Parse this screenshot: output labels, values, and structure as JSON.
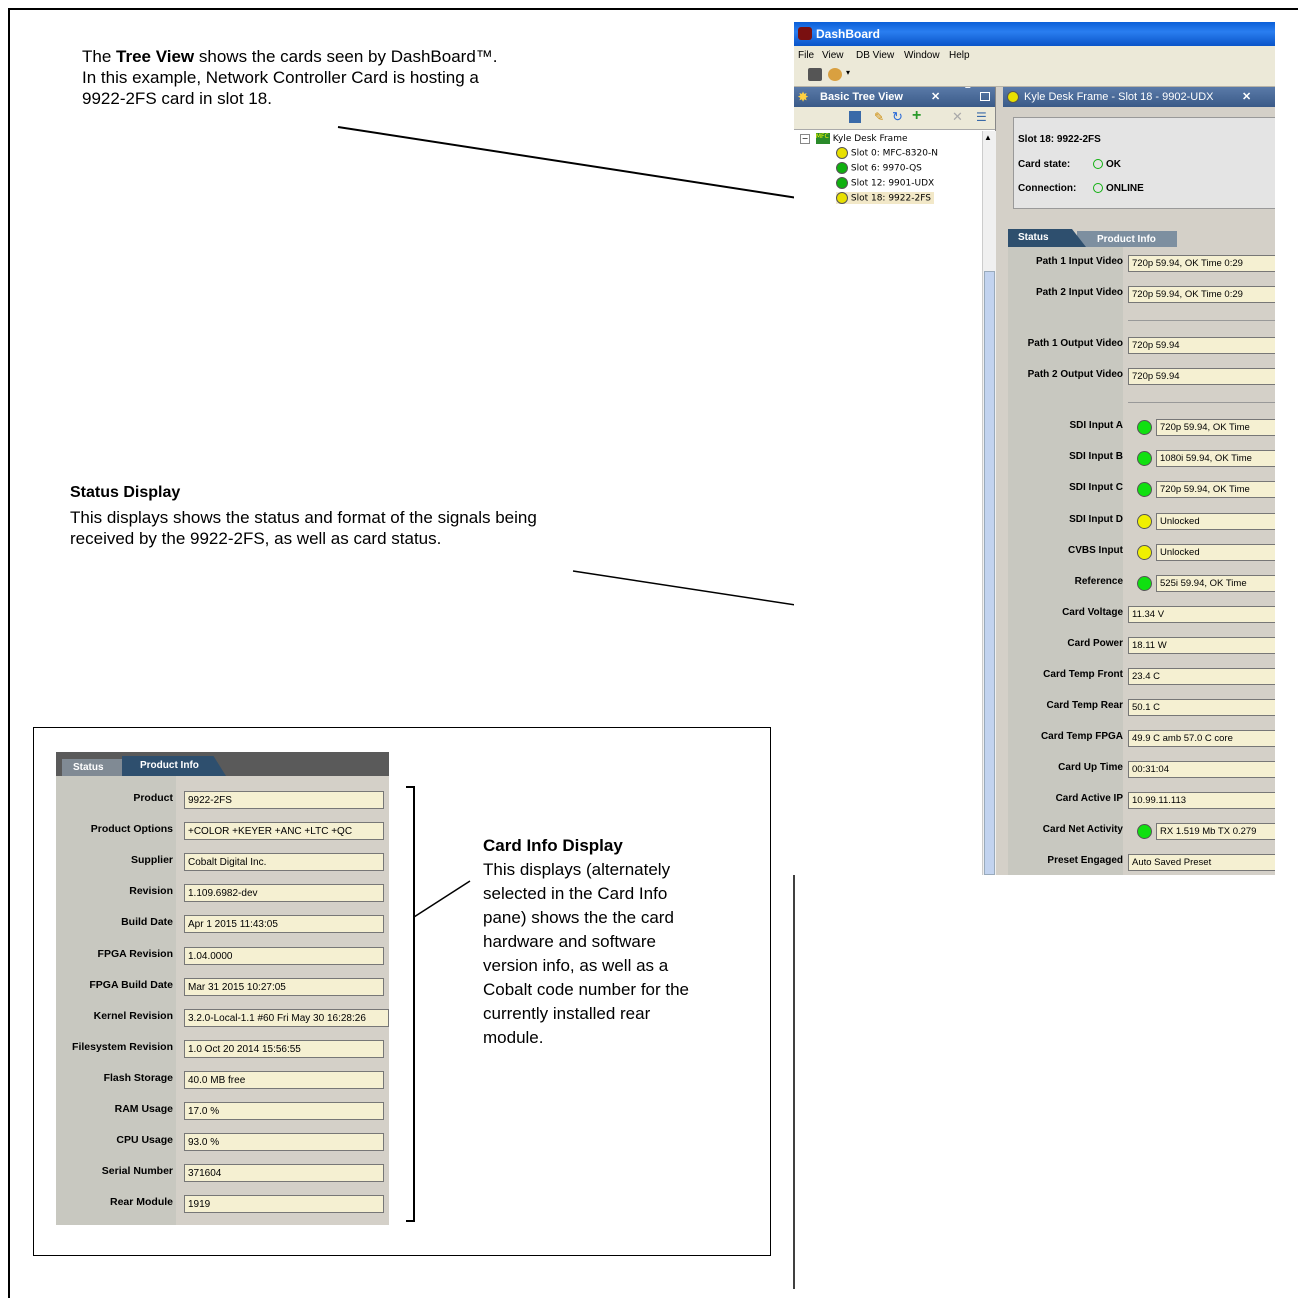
{
  "callouts": {
    "tree_view": {
      "pre": "The ",
      "bold": "Tree View",
      "line1_rest": " shows the cards seen by DashBoard™.",
      "line2": "In this example, Network Controller Card is hosting a",
      "line3": "9922-2FS card in slot 18."
    },
    "status_display": {
      "title": "Status Display",
      "line1": "This displays shows the status and format of the signals being",
      "line2": "received by the 9922-2FS, as well as card status."
    },
    "card_info": {
      "title": "Card Info Display",
      "lines": [
        "This displays (alternately",
        "selected in the Card Info",
        "pane) shows the the card",
        "hardware and software",
        "version info, as well as a",
        "Cobalt code number for the",
        "currently installed rear",
        "module."
      ]
    }
  },
  "app": {
    "title": "DashBoard",
    "menu": [
      "File",
      "View",
      "DB View",
      "Window",
      "Help"
    ]
  },
  "tree_panel": {
    "header": "Basic Tree View",
    "root": "Kyle Desk Frame",
    "root_icon_text": "MFC",
    "slots": [
      {
        "label": "Slot 0: MFC-8320-N",
        "color": "#e8e000"
      },
      {
        "label": "Slot 6: 9970-QS",
        "color": "#10b010"
      },
      {
        "label": "Slot 12: 9901-UDX",
        "color": "#10b010"
      },
      {
        "label": "Slot 18: 9922-2FS",
        "color": "#e8e000"
      }
    ]
  },
  "card_panel": {
    "tab_title": "Kyle Desk Frame - Slot 18 - 9902-UDX",
    "slot_title": "Slot 18: 9922-2FS",
    "card_state_label": "Card state:",
    "card_state_value": "OK",
    "connection_label": "Connection:",
    "connection_value": "ONLINE",
    "tabs": [
      "Status",
      "Product Info"
    ],
    "rows": [
      {
        "label": "Path 1 Input Video",
        "value": "720p 59.94, OK Time 0:29",
        "led": null
      },
      {
        "label": "Path 2 Input Video",
        "value": "720p 59.94, OK Time 0:29",
        "led": null
      },
      {
        "label": "Path 1 Output Video",
        "value": "720p 59.94",
        "led": null
      },
      {
        "label": "Path 2 Output Video",
        "value": "720p 59.94",
        "led": null
      },
      {
        "label": "SDI Input A",
        "value": "720p 59.94, OK Time",
        "led": "#10e010"
      },
      {
        "label": "SDI Input B",
        "value": "1080i 59.94, OK Time",
        "led": "#10e010"
      },
      {
        "label": "SDI Input C",
        "value": "720p 59.94, OK Time",
        "led": "#10e010"
      },
      {
        "label": "SDI Input D",
        "value": "Unlocked",
        "led": "#f0f000"
      },
      {
        "label": "CVBS Input",
        "value": "Unlocked",
        "led": "#f0f000"
      },
      {
        "label": "Reference",
        "value": "525i 59.94, OK Time",
        "led": "#10e010"
      },
      {
        "label": "Card Voltage",
        "value": "11.34 V",
        "led": null
      },
      {
        "label": "Card Power",
        "value": "18.11 W",
        "led": null
      },
      {
        "label": "Card Temp Front",
        "value": "23.4 C",
        "led": null
      },
      {
        "label": "Card Temp Rear",
        "value": "50.1 C",
        "led": null
      },
      {
        "label": "Card Temp FPGA",
        "value": "49.9 C amb 57.0 C core",
        "led": null
      },
      {
        "label": "Card Up Time",
        "value": "00:31:04",
        "led": null
      },
      {
        "label": "Card Active IP",
        "value": "10.99.11.113",
        "led": null
      },
      {
        "label": "Card Net Activity",
        "value": "RX 1.519 Mb TX 0.279",
        "led": "#10e010"
      },
      {
        "label": "Preset Engaged",
        "value": "Auto Saved Preset",
        "led": null
      }
    ]
  },
  "product_info": {
    "tabs": [
      "Status",
      "Product Info"
    ],
    "rows": [
      {
        "label": "Product",
        "value": "9922-2FS"
      },
      {
        "label": "Product Options",
        "value": "+COLOR +KEYER +ANC +LTC +QC"
      },
      {
        "label": "Supplier",
        "value": "Cobalt Digital Inc."
      },
      {
        "label": "Revision",
        "value": "1.109.6982-dev"
      },
      {
        "label": "Build Date",
        "value": "Apr 1 2015 11:43:05"
      },
      {
        "label": "FPGA Revision",
        "value": "1.04.0000"
      },
      {
        "label": "FPGA Build Date",
        "value": "Mar 31 2015 10:27:05"
      },
      {
        "label": "Kernel Revision",
        "value": "3.2.0-Local-1.1 #60 Fri May 30 16:28:26"
      },
      {
        "label": "Filesystem Revision",
        "value": "1.0 Oct 20 2014 15:56:55"
      },
      {
        "label": "Flash Storage",
        "value": "40.0 MB free"
      },
      {
        "label": "RAM Usage",
        "value": "17.0 %"
      },
      {
        "label": "CPU Usage",
        "value": "93.0 %"
      },
      {
        "label": "Serial Number",
        "value": "371604"
      },
      {
        "label": "Rear Module",
        "value": "1919"
      }
    ]
  }
}
